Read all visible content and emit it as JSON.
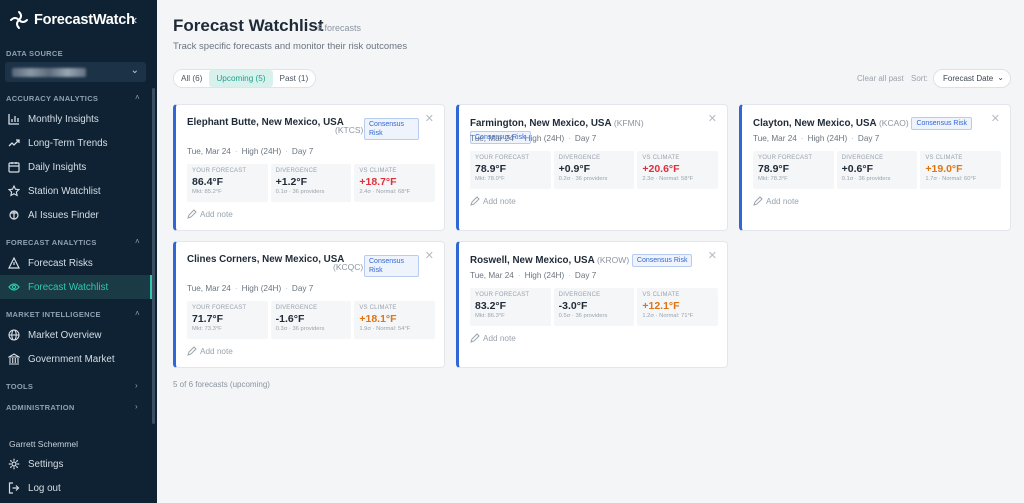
{
  "app": {
    "name": "ForecastWatch"
  },
  "sidebar": {
    "data_source_label": "DATA SOURCE",
    "sections": [
      {
        "label": "ACCURACY ANALYTICS"
      },
      {
        "label": "FORECAST ANALYTICS"
      },
      {
        "label": "MARKET INTELLIGENCE"
      },
      {
        "label": "TOOLS"
      },
      {
        "label": "ADMINISTRATION"
      }
    ],
    "items": [
      {
        "label": "Monthly Insights",
        "icon": "bar-chart-icon"
      },
      {
        "label": "Long-Term Trends",
        "icon": "trend-line-icon"
      },
      {
        "label": "Daily Insights",
        "icon": "calendar-icon"
      },
      {
        "label": "Station Watchlist",
        "icon": "star-icon"
      },
      {
        "label": "AI Issues Finder",
        "icon": "ai-search-icon"
      },
      {
        "label": "Forecast Risks",
        "icon": "warning-icon"
      },
      {
        "label": "Forecast Watchlist",
        "icon": "eye-icon",
        "active": true
      },
      {
        "label": "Market Overview",
        "icon": "globe-icon"
      },
      {
        "label": "Government Market",
        "icon": "landmark-icon"
      }
    ],
    "user_name": "Garrett Schemmel",
    "settings_label": "Settings",
    "logout_label": "Log out"
  },
  "header": {
    "title": "Forecast Watchlist",
    "count": "6 forecasts",
    "subtitle": "Track specific forecasts and monitor their risk outcomes"
  },
  "tabs": [
    {
      "label": "All (6)",
      "active": false
    },
    {
      "label": "Upcoming (5)",
      "active": true
    },
    {
      "label": "Past (1)",
      "active": false
    }
  ],
  "toolbar": {
    "clear_all": "Clear all past",
    "sort_label": "Sort:",
    "sort_value": "Forecast Date"
  },
  "stat_labels": {
    "forecast": "YOUR FORECAST",
    "divergence": "DIVERGENCE",
    "climate": "VS CLIMATE"
  },
  "badge_label": "Consensus Risk",
  "add_note_label": "Add note",
  "cards": [
    {
      "location": "Elephant Butte, New Mexico, USA",
      "code": "(KTCS)",
      "date": "Tue, Mar 24",
      "type": "High (24H)",
      "day": "Day 7",
      "forecast": "86.4°F",
      "forecast_sub": "Mkt: 85.2°F",
      "divergence": "+1.2°F",
      "divergence_sub": "0.1σ · 36 providers",
      "climate": "+18.7°F",
      "climate_sub": "2.4σ · Normal: 68°F",
      "climate_color": "#e0303a"
    },
    {
      "location": "Farmington, New Mexico, USA",
      "code": "(KFMN)",
      "date": "Tue, Mar 24",
      "type": "High (24H)",
      "day": "Day 7",
      "forecast": "78.9°F",
      "forecast_sub": "Mkt: 78.0°F",
      "divergence": "+0.9°F",
      "divergence_sub": "0.2σ · 36 providers",
      "climate": "+20.6°F",
      "climate_sub": "2.3σ · Normal: 58°F",
      "climate_color": "#e0303a"
    },
    {
      "location": "Clayton, New Mexico, USA",
      "code": "(KCAO)",
      "date": "Tue, Mar 24",
      "type": "High (24H)",
      "day": "Day 7",
      "forecast": "78.9°F",
      "forecast_sub": "Mkt: 78.3°F",
      "divergence": "+0.6°F",
      "divergence_sub": "0.1σ · 36 providers",
      "climate": "+19.0°F",
      "climate_sub": "1.7σ · Normal: 60°F",
      "climate_color": "#e07412"
    },
    {
      "location": "Clines Corners, New Mexico, USA",
      "code": "(KCQC)",
      "date": "Tue, Mar 24",
      "type": "High (24H)",
      "day": "Day 7",
      "forecast": "71.7°F",
      "forecast_sub": "Mkt: 73.3°F",
      "divergence": "-1.6°F",
      "divergence_sub": "0.3σ · 36 providers",
      "climate": "+18.1°F",
      "climate_sub": "1.9σ · Normal: 54°F",
      "climate_color": "#e07412"
    },
    {
      "location": "Roswell, New Mexico, USA",
      "code": "(KROW)",
      "date": "Tue, Mar 24",
      "type": "High (24H)",
      "day": "Day 7",
      "forecast": "83.2°F",
      "forecast_sub": "Mkt: 86.3°F",
      "divergence": "-3.0°F",
      "divergence_sub": "0.5σ · 36 providers",
      "climate": "+12.1°F",
      "climate_sub": "1.2σ · Normal: 71°F",
      "climate_color": "#e07412"
    }
  ],
  "footer": "5 of 6 forecasts (upcoming)"
}
